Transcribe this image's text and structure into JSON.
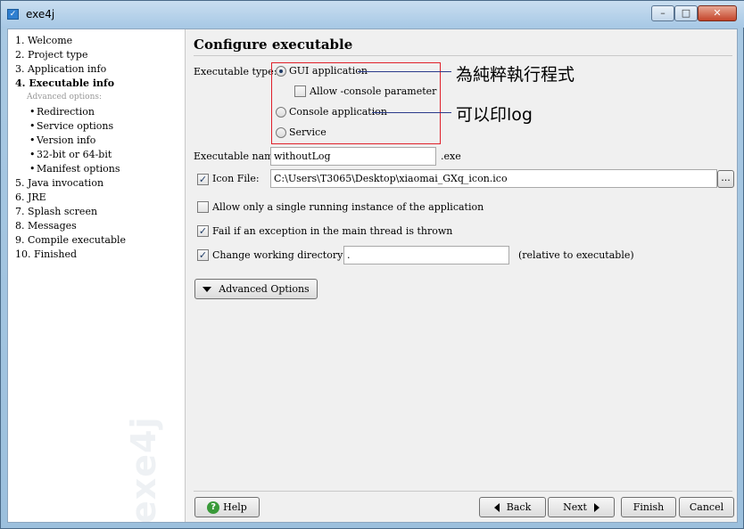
{
  "window": {
    "title": "exe4j"
  },
  "sidebar": {
    "steps": [
      "1. Welcome",
      "2. Project type",
      "3. Application info",
      "4. Executable info",
      "5. Java invocation",
      "6. JRE",
      "7. Splash screen",
      "8. Messages",
      "9. Compile executable",
      "10. Finished"
    ],
    "sub_header": "Advanced options:",
    "sub_steps": [
      "Redirection",
      "Service options",
      "Version info",
      "32-bit or 64-bit",
      "Manifest options"
    ],
    "watermark": "exe4j"
  },
  "main": {
    "title": "Configure executable",
    "exec_type_label": "Executable type:",
    "options": {
      "gui": "GUI application",
      "allow_console": "Allow -console parameter",
      "console": "Console application",
      "service": "Service"
    },
    "selected_type": "GUI application",
    "exec_name_label": "Executable name:",
    "exec_name_value": "withoutLog",
    "exec_ext": ".exe",
    "icon_file_label": "Icon File:",
    "icon_file_value": "C:\\Users\\T3065\\Desktop\\xiaomai_GXq_icon.ico",
    "browse_label": "...",
    "single_instance_label": "Allow only a single running instance of the application",
    "fail_exception_label": "Fail if an exception in the main thread is thrown",
    "change_dir_label": "Change working directory to:",
    "change_dir_value": ".",
    "relative_note": "(relative to executable)",
    "advanced_options_label": "Advanced Options"
  },
  "checks": {
    "allow_console": false,
    "icon_file": true,
    "single_instance": false,
    "fail_exception": true,
    "change_dir": true
  },
  "annotations": {
    "gui_note": "為純粹執行程式",
    "console_note": "可以印log"
  },
  "footer": {
    "help": "Help",
    "back": "Back",
    "next": "Next",
    "finish": "Finish",
    "cancel": "Cancel"
  },
  "colors": {
    "annotation_box": "#e0202a",
    "annotation_line": "#2a3a8a"
  }
}
